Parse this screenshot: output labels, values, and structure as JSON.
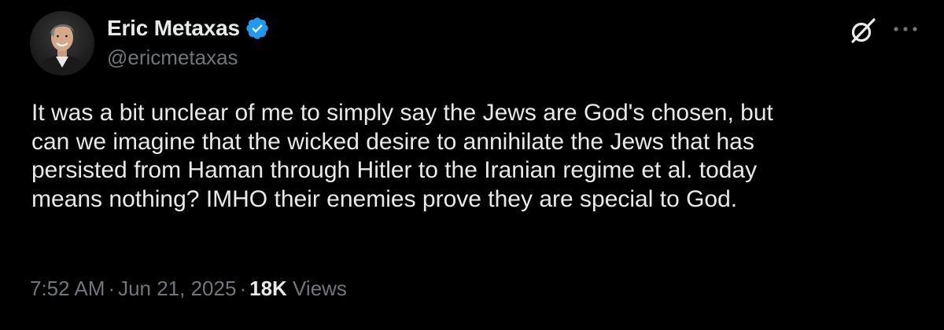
{
  "author": {
    "display_name": "Eric Metaxas",
    "handle": "@ericmetaxas",
    "verified": true,
    "avatar_icon": "profile-photo-avatar"
  },
  "header_actions": {
    "grok_icon": "grok-icon",
    "more_icon": "more-dots-icon"
  },
  "tweet": {
    "lines": [
      "It was a bit unclear of me to simply say the Jews are God's chosen, but",
      "can we imagine that the wicked desire to annihilate the Jews that has",
      "persisted from Haman through Hitler to the Iranian regime et al. today",
      "means nothing? IMHO their enemies prove they are special to God."
    ]
  },
  "meta": {
    "time": "7:52 AM",
    "separator": "·",
    "date": "Jun 21, 2025",
    "views_count": "18K",
    "views_label": "Views"
  },
  "colors": {
    "background": "#000000",
    "primary_text": "#e7e9ea",
    "secondary_text": "#71767b",
    "verified_blue": "#1d9bf0"
  }
}
